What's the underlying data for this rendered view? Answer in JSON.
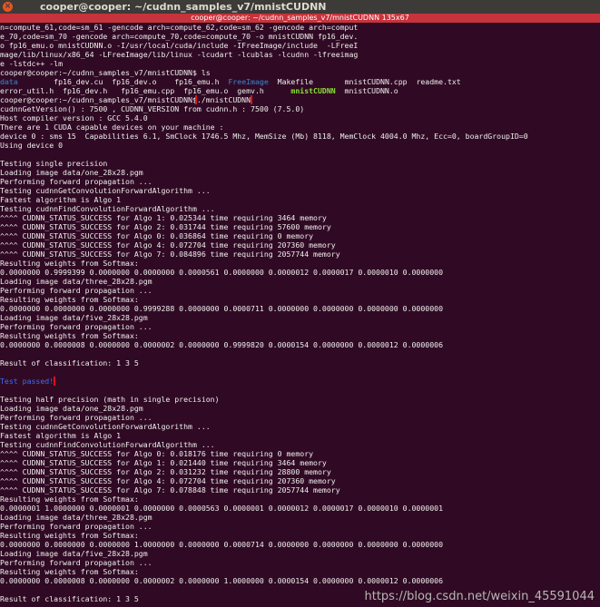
{
  "window": {
    "title": "cooper@cooper: ~/cudnn_samples_v7/mnistCUDNN",
    "close_glyph": "×"
  },
  "tab": {
    "title": "cooper@cooper: ~/cudnn_samples_v7/mnistCUDNN 135x67"
  },
  "colors": {
    "terminal_bg": "#300a24",
    "text": "#eeeeec",
    "directory_blue": "#3465a4",
    "executable_green": "#8ae234",
    "highlight_red": "#e0101a",
    "passed_blue": "#3b6cff"
  },
  "terminal": {
    "build_output": [
      "n=compute_61,code=sm_61 -gencode arch=compute_62,code=sm_62 -gencode arch=comput",
      "e_70,code=sm_70 -gencode arch=compute_70,code=compute_70 -o mnistCUDNN fp16_dev.",
      "o fp16_emu.o mnistCUDNN.o -I/usr/local/cuda/include -IFreeImage/include  -LFreeI",
      "mage/lib/linux/x86_64 -LFreeImage/lib/linux -lcudart -lcublas -lcudnn -lfreeimag",
      "e -lstdc++ -lm"
    ],
    "prompt": "cooper@cooper:~/cudnn_samples_v7/mnistCUDNN$",
    "ls_command": "ls",
    "ls_row1": {
      "data": "data",
      "pad1": "        ",
      "mid": "fp16_dev.cu  fp16_dev.o    fp16_emu.h  ",
      "freeimage": "FreeImage",
      "rest": "  Makefile       mnistCUDNN.cpp  readme.txt"
    },
    "ls_row2": {
      "start": "error_util.h  fp16_dev.h   fp16_emu.cpp  fp16_emu.o  gemv.h      ",
      "exe": "mnistCUDNN",
      "rest": "  mnistCUDNN.o"
    },
    "run_command": "./mnistCUDNN",
    "output_1": [
      "cudnnGetVersion() : 7500 , CUDNN_VERSION from cudnn.h : 7500 (7.5.0)",
      "Host compiler version : GCC 5.4.0",
      "There are 1 CUDA capable devices on your machine :",
      "device 0 : sms 15  Capabilities 6.1, SmClock 1746.5 Mhz, MemSize (Mb) 8118, MemClock 4004.0 Mhz, Ecc=0, boardGroupID=0",
      "Using device 0",
      "",
      "Testing single precision",
      "Loading image data/one_28x28.pgm",
      "Performing forward propagation ...",
      "Testing cudnnGetConvolutionForwardAlgorithm ...",
      "Fastest algorithm is Algo 1",
      "Testing cudnnFindConvolutionForwardAlgorithm ...",
      "^^^^ CUDNN_STATUS_SUCCESS for Algo 1: 0.025344 time requiring 3464 memory",
      "^^^^ CUDNN_STATUS_SUCCESS for Algo 2: 0.031744 time requiring 57600 memory",
      "^^^^ CUDNN_STATUS_SUCCESS for Algo 0: 0.036864 time requiring 0 memory",
      "^^^^ CUDNN_STATUS_SUCCESS for Algo 4: 0.072704 time requiring 207360 memory",
      "^^^^ CUDNN_STATUS_SUCCESS for Algo 7: 0.084896 time requiring 2057744 memory",
      "Resulting weights from Softmax:",
      "0.0000000 0.9999399 0.0000000 0.0000000 0.0000561 0.0000000 0.0000012 0.0000017 0.0000010 0.0000000",
      "Loading image data/three_28x28.pgm",
      "Performing forward propagation ...",
      "Resulting weights from Softmax:",
      "0.0000000 0.0000000 0.0000000 0.9999288 0.0000000 0.0000711 0.0000000 0.0000000 0.0000000 0.0000000",
      "Loading image data/five_28x28.pgm",
      "Performing forward propagation ...",
      "Resulting weights from Softmax:",
      "0.0000000 0.0000008 0.0000000 0.0000002 0.0000000 0.9999820 0.0000154 0.0000000 0.0000012 0.0000006",
      "",
      "Result of classification: 1 3 5",
      ""
    ],
    "test_passed": "Test passed!",
    "output_2": [
      "",
      "Testing half precision (math in single precision)",
      "Loading image data/one_28x28.pgm",
      "Performing forward propagation ...",
      "Testing cudnnGetConvolutionForwardAlgorithm ...",
      "Fastest algorithm is Algo 1",
      "Testing cudnnFindConvolutionForwardAlgorithm ...",
      "^^^^ CUDNN_STATUS_SUCCESS for Algo 0: 0.018176 time requiring 0 memory",
      "^^^^ CUDNN_STATUS_SUCCESS for Algo 1: 0.021440 time requiring 3464 memory",
      "^^^^ CUDNN_STATUS_SUCCESS for Algo 2: 0.031232 time requiring 28800 memory",
      "^^^^ CUDNN_STATUS_SUCCESS for Algo 4: 0.072704 time requiring 207360 memory",
      "^^^^ CUDNN_STATUS_SUCCESS for Algo 7: 0.078848 time requiring 2057744 memory",
      "Resulting weights from Softmax:",
      "0.0000001 1.0000000 0.0000001 0.0000000 0.0000563 0.0000001 0.0000012 0.0000017 0.0000010 0.0000001",
      "Loading image data/three_28x28.pgm",
      "Performing forward propagation ...",
      "Resulting weights from Softmax:",
      "0.0000000 0.0000000 0.0000000 1.0000000 0.0000000 0.0000714 0.0000000 0.0000000 0.0000000 0.0000000",
      "Loading image data/five_28x28.pgm",
      "Performing forward propagation ...",
      "Resulting weights from Softmax:",
      "0.0000000 0.0000008 0.0000000 0.0000002 0.0000000 1.0000000 0.0000154 0.0000000 0.0000012 0.0000006",
      "",
      "Result of classification: 1 3 5"
    ]
  },
  "watermark": "https://blog.csdn.net/weixin_45591044"
}
